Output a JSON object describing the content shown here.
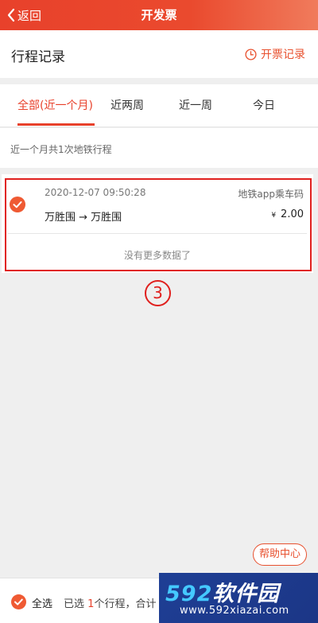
{
  "header": {
    "back_label": "返回",
    "title": "开发票"
  },
  "section": {
    "title": "行程记录",
    "invoice_record_label": "开票记录"
  },
  "tabs": [
    {
      "label": "全部(近一个月)",
      "active": true
    },
    {
      "label": "近两周",
      "active": false
    },
    {
      "label": "近一周",
      "active": false
    },
    {
      "label": "今日",
      "active": false
    }
  ],
  "summary": "近一个月共1次地铁行程",
  "trip": {
    "time": "2020-12-07 09:50:28",
    "source": "地铁app乘车码",
    "route": "万胜围 → 万胜围",
    "currency": "¥",
    "price": "2.00",
    "selected": true
  },
  "no_more_text": "没有更多数据了",
  "step_mark": "3",
  "help_button": "帮助中心",
  "bottom": {
    "select_all_label": "全选",
    "selected_prefix": "已选",
    "selected_count": "1",
    "selected_suffix": "个行程，合计"
  },
  "watermark": {
    "brand_num": "592",
    "brand_text": "软件园",
    "url": "www.592xiazai.com"
  },
  "colors": {
    "accent": "#e8412b",
    "frame": "#e0201e",
    "watermark_bg": "#1e3f95"
  }
}
